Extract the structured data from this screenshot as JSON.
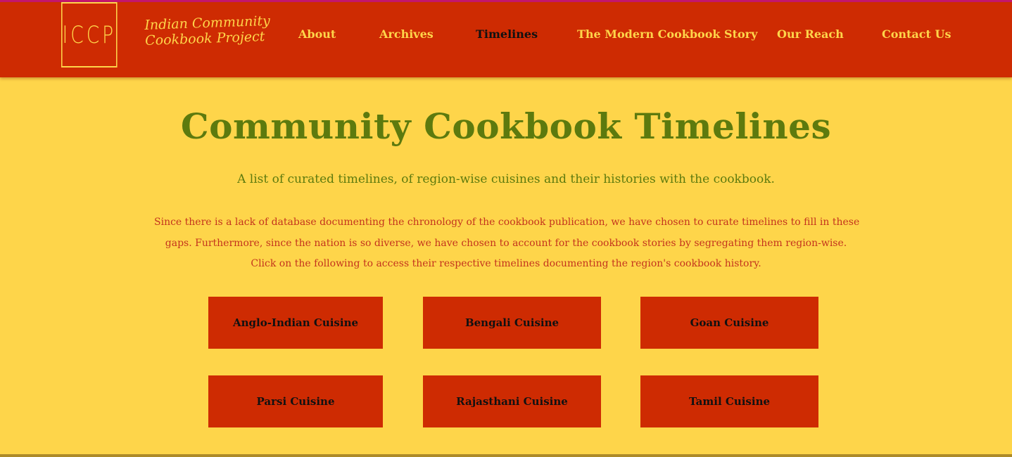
{
  "logo": {
    "mark": "ICCP",
    "name_line1": "Indian Community",
    "name_line2": "Cookbook Project"
  },
  "nav": {
    "items": [
      {
        "label": "About"
      },
      {
        "label": "Archives"
      },
      {
        "label": "Timelines",
        "active": true
      },
      {
        "label": "The Modern Cookbook Story"
      },
      {
        "label": "Our Reach"
      },
      {
        "label": "Contact Us"
      }
    ]
  },
  "main": {
    "title": "Community Cookbook Timelines",
    "subtitle": "A list of curated timelines, of region-wise cuisines and their histories with the cookbook.",
    "body_lines": [
      "Since there is a lack of database documenting the chronology of the cookbook publication, we have chosen to curate timelines to fill in these",
      "gaps. Furthermore, since the nation is so diverse, we have chosen to account for the cookbook stories by segregating them region-wise.",
      "Click on the following to access their respective timelines documenting the region's cookbook history."
    ],
    "cuisines": [
      {
        "label": "Anglo-Indian Cuisine"
      },
      {
        "label": "Bengali Cuisine"
      },
      {
        "label": "Goan Cuisine"
      },
      {
        "label": "Parsi Cuisine"
      },
      {
        "label": "Rajasthani Cuisine"
      },
      {
        "label": "Tamil Cuisine"
      }
    ]
  },
  "colors": {
    "header_bg": "#ce2b02",
    "page_bg": "#fed54a",
    "accent_yellow": "#fed54a",
    "title_green": "#5d7a0e",
    "body_red": "#c4341d"
  }
}
